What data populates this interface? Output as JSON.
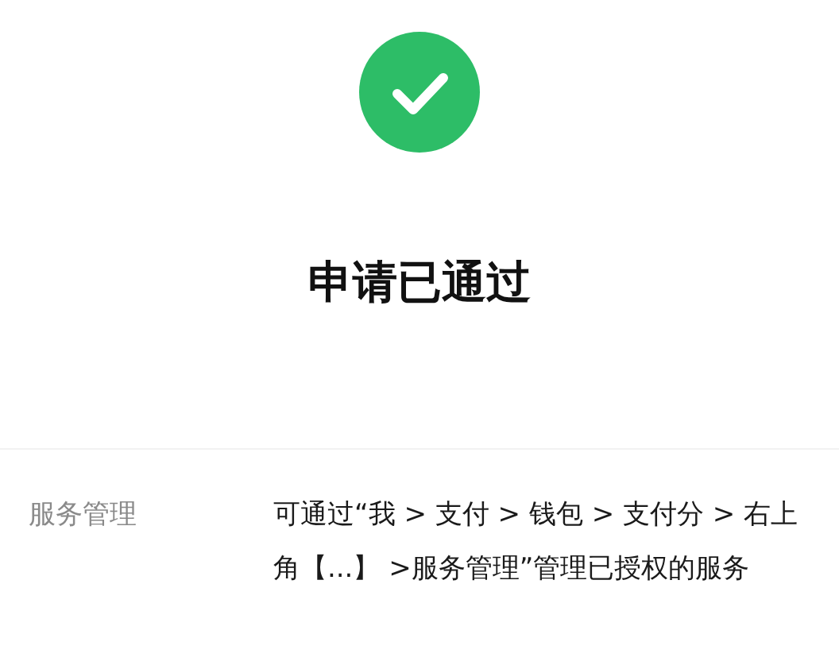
{
  "status": {
    "title": "申请已通过"
  },
  "details": [
    {
      "label": "服务管理",
      "value": "可通过“我 > 支付 > 钱包 > 支付分 > 右上角【...】 >服务管理”管理已授权的服务"
    }
  ]
}
